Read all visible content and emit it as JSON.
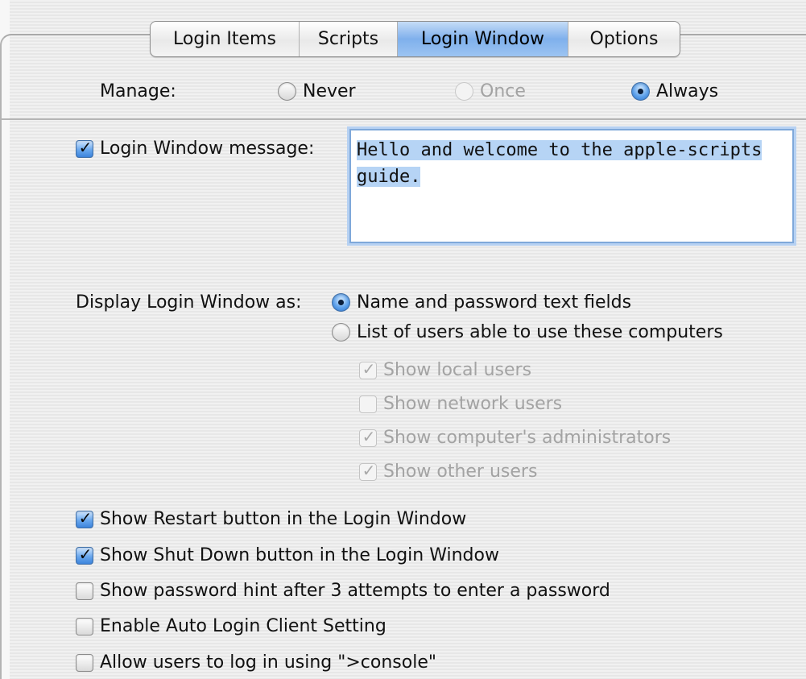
{
  "tabs": [
    {
      "label": "Login Items",
      "active": false
    },
    {
      "label": "Scripts",
      "active": false
    },
    {
      "label": "Login Window",
      "active": true
    },
    {
      "label": "Options",
      "active": false
    }
  ],
  "manage": {
    "label": "Manage:",
    "options": [
      {
        "label": "Never",
        "selected": false,
        "enabled": true
      },
      {
        "label": "Once",
        "selected": false,
        "enabled": false
      },
      {
        "label": "Always",
        "selected": true,
        "enabled": true
      }
    ]
  },
  "login_message": {
    "label": "Login Window message:",
    "checked": true,
    "value": "Hello and welcome to the apple-scripts guide.",
    "line1": "Hello and welcome to the apple-scripts",
    "line2": "guide."
  },
  "display_as": {
    "label": "Display Login Window as:",
    "options": [
      {
        "label": "Name and password text fields",
        "selected": true
      },
      {
        "label": "List of users able to use these computers",
        "selected": false
      }
    ],
    "sub_options": [
      {
        "label": "Show local users",
        "checked": true,
        "enabled": false
      },
      {
        "label": "Show network users",
        "checked": false,
        "enabled": false
      },
      {
        "label": "Show computer's administrators",
        "checked": true,
        "enabled": false
      },
      {
        "label": "Show other users",
        "checked": true,
        "enabled": false
      }
    ]
  },
  "options": [
    {
      "label": "Show Restart button in the Login Window",
      "checked": true
    },
    {
      "label": "Show Shut Down button in the Login Window",
      "checked": true
    },
    {
      "label": "Show password hint after 3 attempts to enter a password",
      "checked": false
    },
    {
      "label": "Enable Auto Login Client Setting",
      "checked": false
    },
    {
      "label": "Allow users to log in using \">console\"",
      "checked": false
    }
  ],
  "colors": {
    "accent": "#5fa2eb",
    "selection": "#b6d4f5",
    "disabled_text": "#a3a3a3"
  }
}
